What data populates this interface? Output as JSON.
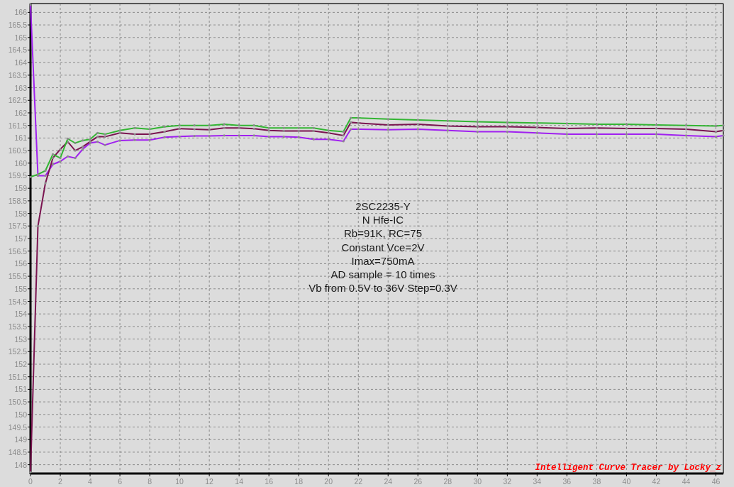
{
  "chart_data": {
    "type": "line",
    "x": [
      0,
      0.5,
      1,
      1.5,
      2,
      2.5,
      3,
      3.5,
      4,
      4.5,
      5,
      6,
      7,
      8,
      9,
      10,
      11,
      12,
      13,
      14,
      15,
      16,
      17,
      18,
      19,
      20,
      21,
      21.5,
      22,
      24,
      26,
      28,
      30,
      32,
      34,
      36,
      38,
      40,
      42,
      44,
      46,
      46.5
    ],
    "series": [
      {
        "color": "#a020f0",
        "values": [
          166.3,
          159.5,
          159.5,
          159.95,
          160.07,
          160.27,
          160.2,
          160.55,
          160.8,
          160.85,
          160.72,
          160.9,
          160.92,
          160.92,
          161.03,
          161.06,
          161.08,
          161.08,
          161.1,
          161.1,
          161.1,
          161.05,
          161.05,
          161.03,
          160.95,
          160.95,
          160.87,
          161.35,
          161.35,
          161.33,
          161.35,
          161.3,
          161.25,
          161.25,
          161.2,
          161.15,
          161.15,
          161.15,
          161.15,
          161.1,
          161.05,
          161.1
        ]
      },
      {
        "color": "#7a1450",
        "values": [
          147.7,
          157.5,
          159.2,
          160.2,
          160.55,
          160.85,
          160.5,
          160.65,
          160.85,
          161.05,
          161.05,
          161.2,
          161.15,
          161.15,
          161.25,
          161.37,
          161.35,
          161.33,
          161.4,
          161.4,
          161.37,
          161.3,
          161.28,
          161.28,
          161.28,
          161.2,
          161.1,
          161.62,
          161.6,
          161.52,
          161.55,
          161.48,
          161.45,
          161.45,
          161.42,
          161.38,
          161.4,
          161.38,
          161.38,
          161.35,
          161.25,
          161.3
        ]
      },
      {
        "color": "#33b533",
        "values": [
          159.45,
          159.55,
          159.7,
          160.35,
          160.2,
          160.97,
          160.8,
          160.9,
          160.95,
          161.2,
          161.15,
          161.3,
          161.4,
          161.35,
          161.45,
          161.5,
          161.5,
          161.5,
          161.55,
          161.5,
          161.5,
          161.4,
          161.4,
          161.4,
          161.4,
          161.3,
          161.25,
          161.8,
          161.8,
          161.75,
          161.72,
          161.68,
          161.65,
          161.62,
          161.6,
          161.58,
          161.55,
          161.55,
          161.52,
          161.5,
          161.48,
          161.5
        ]
      }
    ],
    "grid": true,
    "xlim": [
      0,
      46.5
    ],
    "ylim": [
      147.65,
      166.35
    ],
    "xticks": [
      0,
      2,
      4,
      6,
      8,
      10,
      12,
      14,
      16,
      18,
      20,
      22,
      24,
      26,
      28,
      30,
      32,
      34,
      36,
      38,
      40,
      42,
      44,
      46
    ],
    "yticks": [
      148,
      148.5,
      149,
      149.5,
      150,
      150.5,
      151,
      151.5,
      152,
      152.5,
      153,
      153.5,
      154,
      154.5,
      155,
      155.5,
      156,
      156.5,
      157,
      157.5,
      158,
      158.5,
      159,
      159.5,
      160,
      160.5,
      161,
      161.5,
      162,
      162.5,
      163,
      163.5,
      164,
      164.5,
      165,
      165.5,
      166
    ],
    "annotations": [
      "2SC2235-Y",
      "N Hfe-IC",
      "Rb=91K, RC=75",
      "Constant Vce=2V",
      "Imax=750mA",
      "AD sample = 10 times",
      "Vb from 0.5V to 36V Step=0.3V"
    ]
  },
  "signature": "Intelligent Curve Tracer by Locky_z"
}
